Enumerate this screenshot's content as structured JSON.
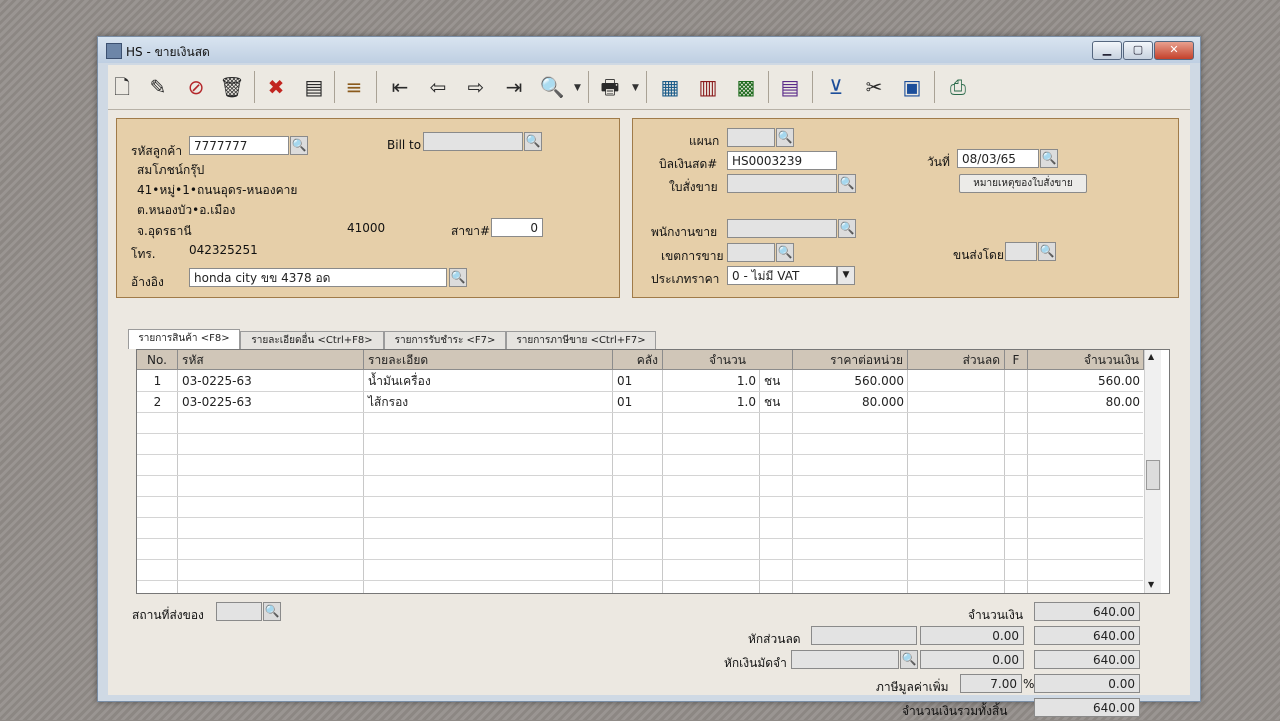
{
  "window": {
    "title": "HS - ขายเงินสด",
    "min": "▁",
    "max": "▢",
    "close": "✕"
  },
  "toolbar": {
    "icons": [
      "new-doc-icon",
      "edit-icon",
      "delete-doc-icon",
      "trash-icon",
      "cancel-icon",
      "save-icon",
      "stack-icon",
      "first-icon",
      "prev-icon",
      "next-icon",
      "last-icon",
      "search-icon",
      "print-icon",
      "view1-icon",
      "view2-icon",
      "view3-icon",
      "batch-icon",
      "approve-icon",
      "approve2-icon",
      "approve3-icon",
      "export-icon"
    ]
  },
  "customer": {
    "code_label": "รหัสลูกค้า",
    "code": "7777777",
    "billto_label": "Bill to",
    "billto": "",
    "name": "สมโภชน์กรุ๊ป",
    "addr1": "41•หมู่•1•ถนนอุดร-หนองคาย",
    "addr2": "ต.หนองบัว•อ.เมือง",
    "addr3": "จ.อุดรธานี",
    "zip": "41000",
    "branch_label": "สาขา#",
    "branch": "0",
    "phone_label": "โทร.",
    "phone": "042325251",
    "ref_label": "อ้างอิง",
    "ref": "honda city ขข 4378 อด"
  },
  "doc": {
    "dept_label": "แผนก",
    "dept": "",
    "bill_label": "บิลเงินสด#",
    "bill": "HS0003239",
    "date_label": "วันที่",
    "date": "08/03/65",
    "so_label": "ใบสั่งขาย",
    "so": "",
    "note_btn": "หมายเหตุของใบสั่งขาย",
    "sales_label": "พนักงานขาย",
    "sales": "",
    "area_label": "เขตการขาย",
    "area": "",
    "ship_label": "ขนส่งโดย",
    "ship": "",
    "price_label": "ประเภทราคา",
    "price": "0 - ไม่มี VAT"
  },
  "tabs": [
    "รายการสินค้า <F8>",
    "รายละเอียดอื่น <Ctrl+F8>",
    "รายการรับชำระ <F7>",
    "รายการภาษีขาย <Ctrl+F7>"
  ],
  "table": {
    "headers": [
      "No.",
      "รหัส",
      "รายละเอียด",
      "คลัง",
      "จำนวน",
      "ราคาต่อหน่วย",
      "ส่วนลด",
      "F",
      "จำนวนเงิน"
    ],
    "rows": [
      {
        "no": "1",
        "code": "03-0225-63",
        "desc": "น้ำมันเครื่อง",
        "wh": "01",
        "qty": "1.0",
        "unit": "ชน",
        "price": "560.000",
        "disc": "",
        "f": "",
        "amount": "560.00"
      },
      {
        "no": "2",
        "code": "03-0225-63",
        "desc": "ไส้กรอง",
        "wh": "01",
        "qty": "1.0",
        "unit": "ชน",
        "price": "80.000",
        "disc": "",
        "f": "",
        "amount": "80.00"
      }
    ]
  },
  "footer": {
    "deliver_label": "สถานที่ส่งของ",
    "deliver": "",
    "amount_label": "จำนวนเงิน",
    "amount": "640.00",
    "discount_label": "หักส่วนลด",
    "discount": "0.00",
    "after_discount": "640.00",
    "deposit_label": "หักเงินมัดจำ",
    "deposit": "0.00",
    "after_deposit": "640.00",
    "vat_label": "ภาษีมูลค่าเพิ่ม",
    "vat_rate": "7.00",
    "vat_pct": "%",
    "vat": "0.00",
    "total_label": "จำนวนเงินรวมทั้งสิ้น",
    "total": "640.00"
  }
}
